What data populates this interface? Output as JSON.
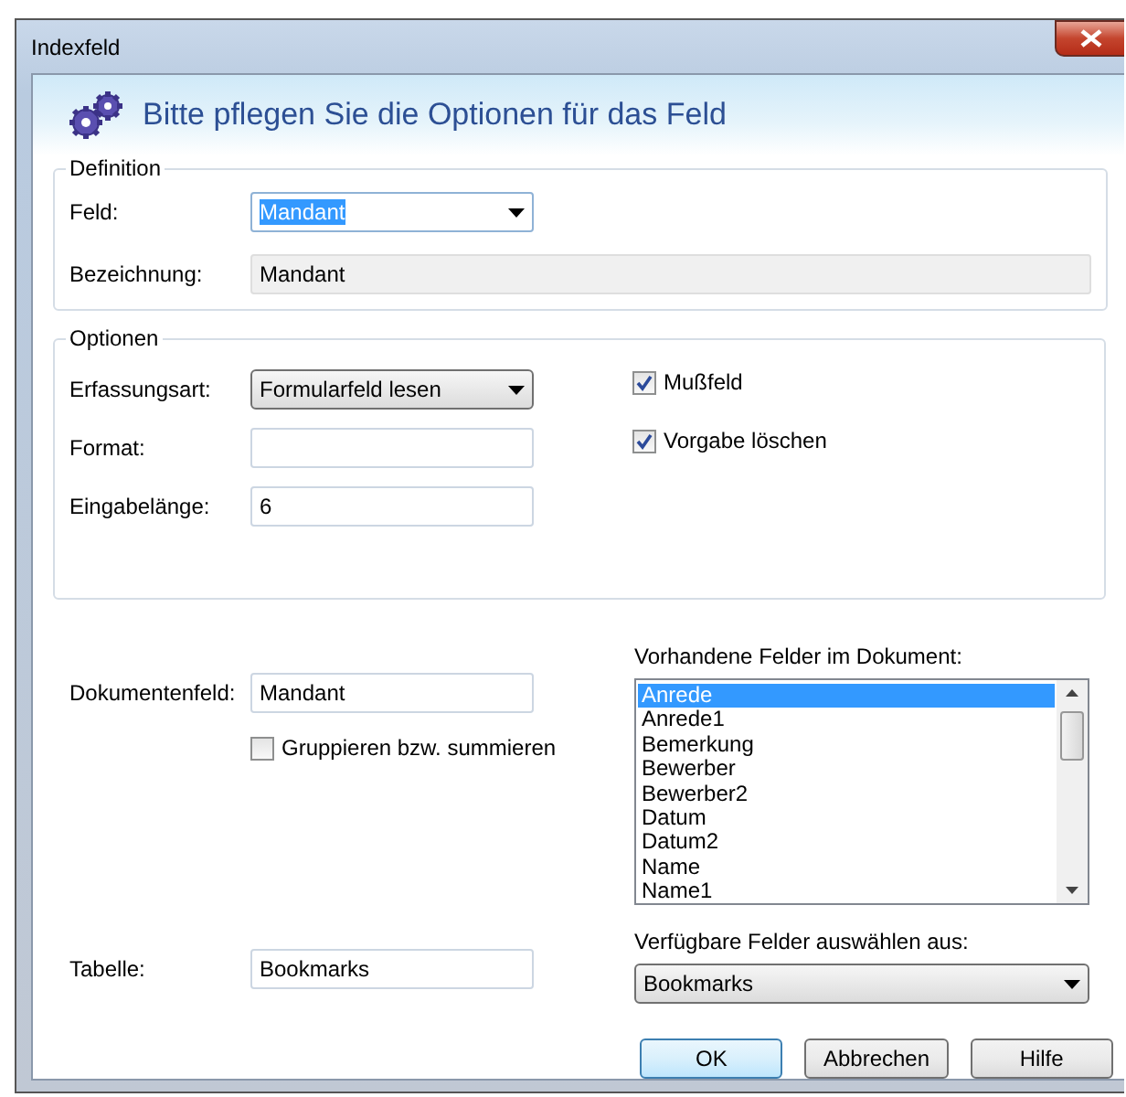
{
  "window": {
    "title": "Indexfeld"
  },
  "header": {
    "title": "Bitte pflegen Sie die Optionen für das Feld"
  },
  "definition": {
    "legend": "Definition",
    "fields": [
      {
        "kind": "dropdown",
        "label": "Feld:",
        "value": "Mandant",
        "text_selected": true
      },
      {
        "kind": "readonly",
        "label": "Bezeichnung:",
        "value": "Mandant"
      }
    ]
  },
  "options": {
    "legend": "Optionen",
    "fields": [
      {
        "kind": "combo",
        "label": "Erfassungsart:",
        "value": "Formularfeld lesen"
      },
      {
        "kind": "text",
        "label": "Format:"
      },
      {
        "kind": "text",
        "label": "Eingabelänge:",
        "value": "6"
      }
    ],
    "checkboxes": [
      {
        "label": "Mußfeld",
        "checked": true
      },
      {
        "label": "Vorgabe löschen",
        "checked": true
      }
    ]
  },
  "document_field": {
    "label": "Dokumentenfeld:",
    "value": "Mandant"
  },
  "group_checkbox": {
    "label": "Gruppieren bzw. summieren",
    "checked": false
  },
  "table_field": {
    "label": "Tabelle:",
    "value": "Bookmarks"
  },
  "field_list": {
    "label": "Vorhandene Felder im Dokument:",
    "items": [
      {
        "text": "Anrede",
        "selected": true
      },
      {
        "text": "Anrede1",
        "selected": false
      },
      {
        "text": "Bemerkung",
        "selected": false
      },
      {
        "text": "Bewerber",
        "selected": false
      },
      {
        "text": "Bewerber2",
        "selected": false
      },
      {
        "text": "Datum",
        "selected": false
      },
      {
        "text": "Datum2",
        "selected": false
      },
      {
        "text": "Name",
        "selected": false
      },
      {
        "text": "Name1",
        "selected": false
      }
    ]
  },
  "source": {
    "label": "Verfügbare Felder auswählen aus:",
    "value": "Bookmarks"
  },
  "buttons": [
    {
      "label": "OK",
      "default": true
    },
    {
      "label": "Abbrechen",
      "default": false
    },
    {
      "label": "Hilfe",
      "default": false
    }
  ]
}
